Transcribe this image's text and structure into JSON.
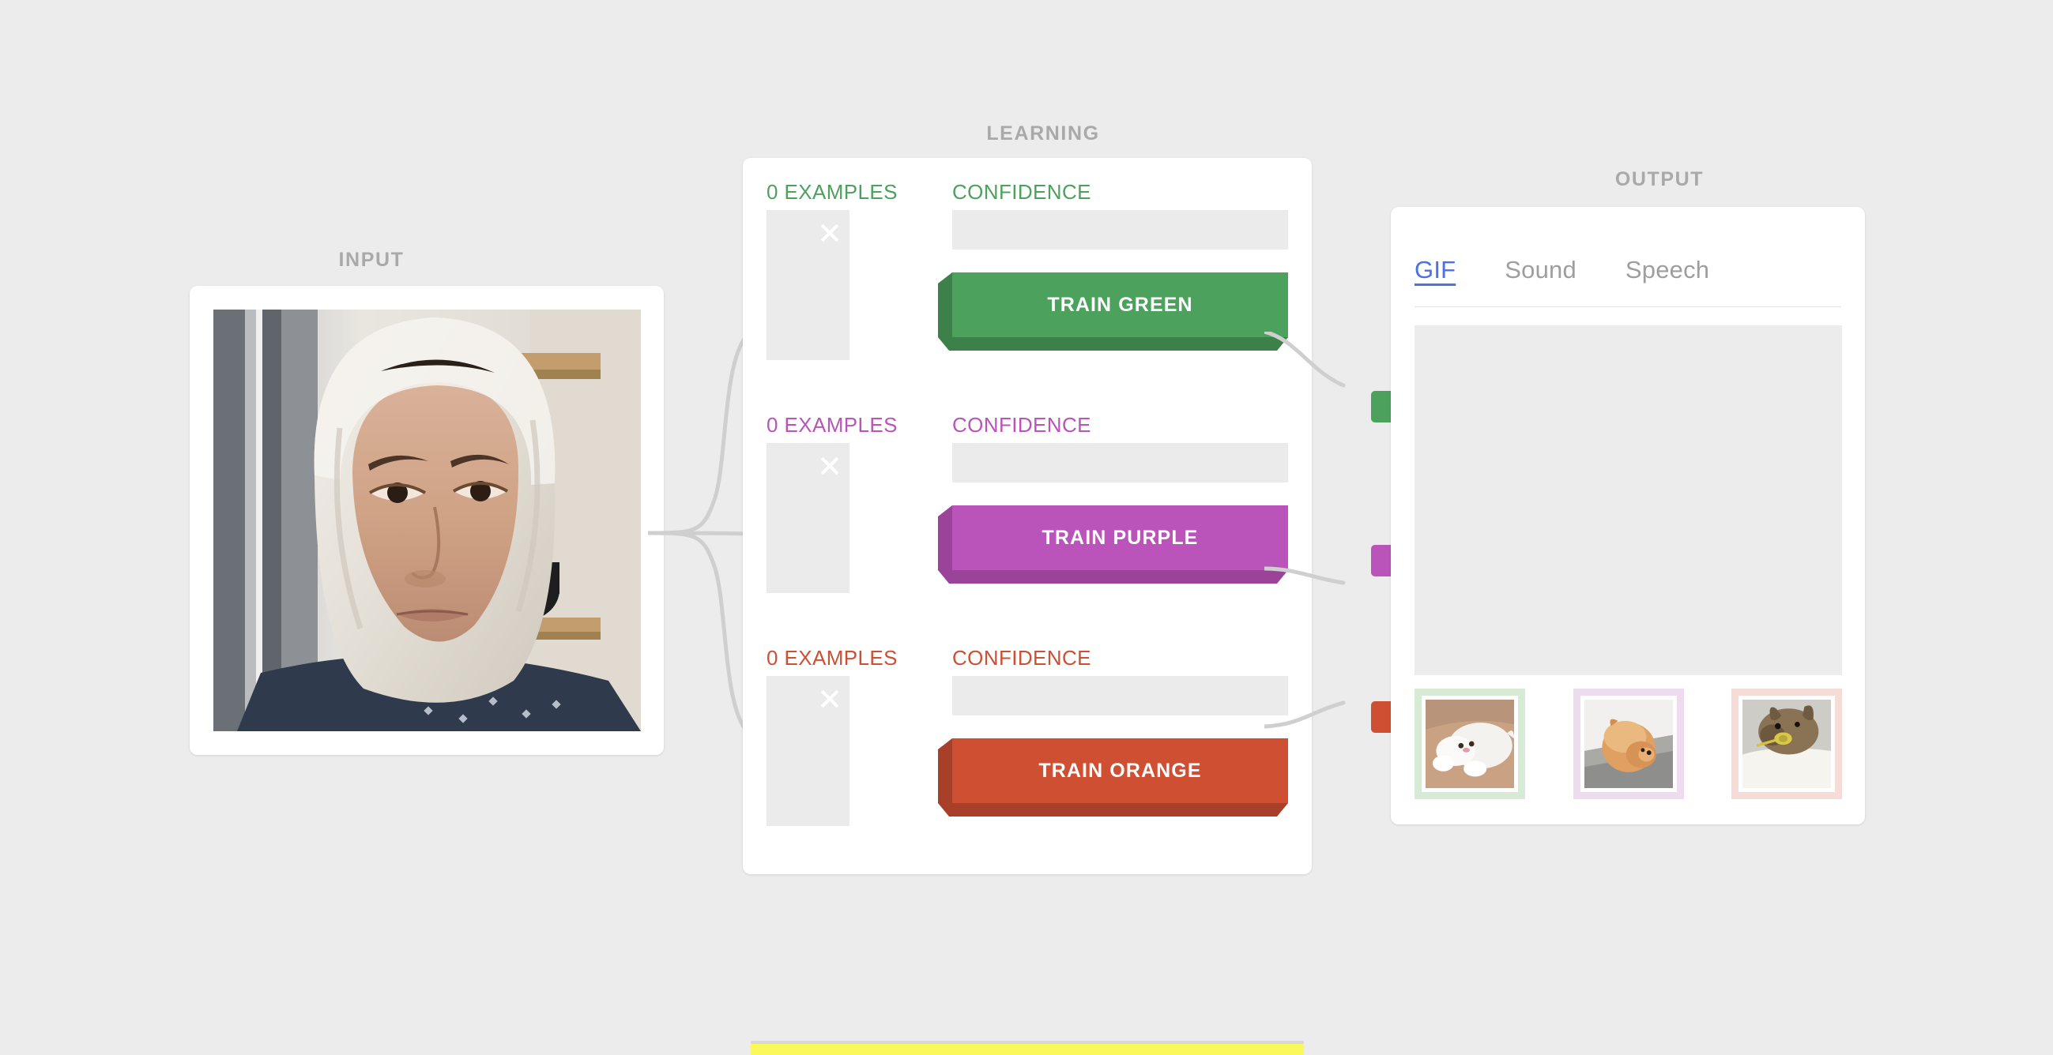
{
  "app": {
    "background_color": "#ececec",
    "label_color": "#a9a9a9"
  },
  "input": {
    "heading": "INPUT",
    "webcam_alt": "webcam-feed"
  },
  "learning": {
    "heading": "LEARNING",
    "classes": [
      {
        "id": "green",
        "examples_label": "0 EXAMPLES",
        "confidence_label": "CONFIDENCE",
        "train_label": "TRAIN GREEN",
        "color": "#4ca25d",
        "shade": "#3d8049",
        "confidence_value": ""
      },
      {
        "id": "purple",
        "examples_label": "0 EXAMPLES",
        "confidence_label": "CONFIDENCE",
        "train_label": "TRAIN PURPLE",
        "color": "#ba54ba",
        "shade": "#9a4399",
        "confidence_value": ""
      },
      {
        "id": "orange",
        "examples_label": "0 EXAMPLES",
        "confidence_label": "CONFIDENCE",
        "train_label": "TRAIN ORANGE",
        "color": "#cf4f33",
        "shade": "#a83f28",
        "confidence_value": ""
      }
    ],
    "clear_icon": "close-x-icon"
  },
  "output": {
    "heading": "OUTPUT",
    "tabs": [
      {
        "label": "GIF",
        "active": true
      },
      {
        "label": "Sound",
        "active": false
      },
      {
        "label": "Speech",
        "active": false
      }
    ],
    "active_tab_color": "#4a71e8",
    "preview_placeholder": "",
    "thumbnails": [
      {
        "name": "white-cat-gif",
        "border_color": "#d6ead6"
      },
      {
        "name": "orange-pomeranian-gif",
        "border_color": "#eedcee"
      },
      {
        "name": "brown-bunny-gif",
        "border_color": "#f5dcd6"
      }
    ]
  },
  "bottom_strip": {
    "color": "#f9f95b"
  }
}
